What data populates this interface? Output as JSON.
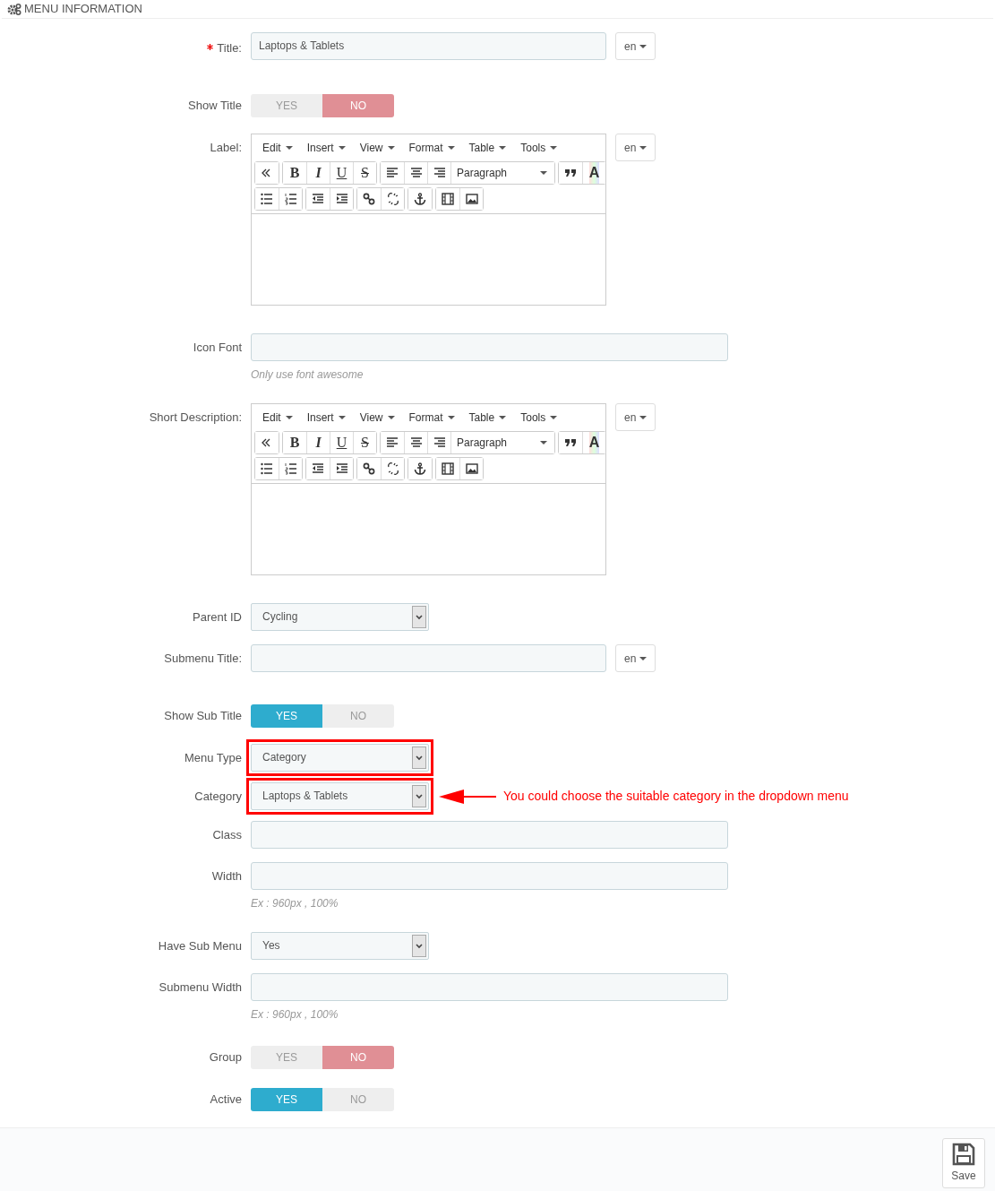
{
  "section_title": "MENU INFORMATION",
  "fields": [
    {
      "kind": "text",
      "label": "Title:",
      "required": true,
      "value": "Laptops & Tablets",
      "lang": "en"
    },
    {
      "kind": "toggle",
      "label": "Show Title",
      "required": false,
      "options": [
        {
          "label": "YES",
          "selected": false
        },
        {
          "label": "NO",
          "selected": true
        }
      ]
    },
    {
      "kind": "editor",
      "label": "Label:",
      "required": false,
      "menu": [
        "Edit",
        "Insert",
        "View",
        "Format",
        "Table",
        "Tools"
      ],
      "glyphs": [
        "B",
        "I",
        "U",
        "S",
        "A"
      ],
      "format": "Paragraph",
      "lang": "en"
    },
    {
      "kind": "wide",
      "label": "Icon Font",
      "required": false,
      "help": "Only use font awesome"
    },
    {
      "kind": "editor",
      "label": "Short Description:",
      "required": false,
      "menu": [
        "Edit",
        "Insert",
        "View",
        "Format",
        "Table",
        "Tools"
      ],
      "glyphs": [
        "B",
        "I",
        "U",
        "S",
        "A"
      ],
      "format": "Paragraph",
      "lang": "en"
    },
    {
      "kind": "select",
      "label": "Parent ID",
      "required": false,
      "value": "Cycling",
      "highlighted": false
    },
    {
      "kind": "text",
      "label": "Submenu Title:",
      "required": false,
      "lang": "en"
    },
    {
      "kind": "toggle",
      "label": "Show Sub Title",
      "required": false,
      "options": [
        {
          "label": "YES",
          "selected": true
        },
        {
          "label": "NO",
          "selected": false
        }
      ]
    },
    {
      "kind": "select",
      "label": "Menu Type",
      "required": false,
      "value": "Category",
      "highlighted": true
    },
    {
      "kind": "select",
      "label": "Category",
      "required": false,
      "value": "Laptops & Tablets",
      "highlighted": true,
      "annotation": "You could choose the suitable category in the dropdown menu"
    },
    {
      "kind": "wide",
      "label": "Class",
      "required": false
    },
    {
      "kind": "wide",
      "label": "Width",
      "required": false,
      "help": "Ex : 960px , 100%"
    },
    {
      "kind": "select",
      "label": "Have Sub Menu",
      "required": false,
      "value": "Yes",
      "highlighted": false
    },
    {
      "kind": "wide",
      "label": "Submenu Width",
      "required": false,
      "help": "Ex : 960px , 100%"
    },
    {
      "kind": "toggle",
      "label": "Group",
      "required": false,
      "options": [
        {
          "label": "YES",
          "selected": false
        },
        {
          "label": "NO",
          "selected": true
        }
      ]
    },
    {
      "kind": "toggle",
      "label": "Active",
      "required": false,
      "options": [
        {
          "label": "YES",
          "selected": true
        },
        {
          "label": "NO",
          "selected": false
        }
      ]
    }
  ],
  "save_button": "Save"
}
